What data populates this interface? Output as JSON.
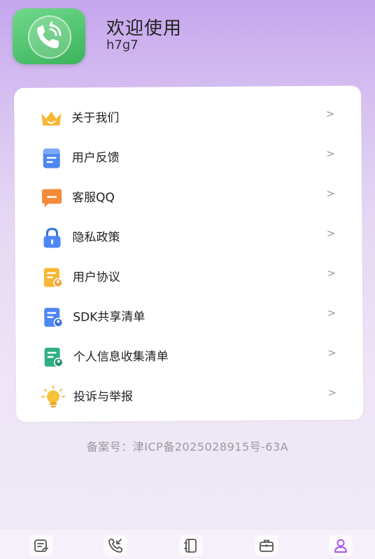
{
  "header": {
    "welcome": "欢迎使用",
    "username": "h7g7",
    "app_icon": "phone-callback-icon"
  },
  "menu": {
    "chevron": ">",
    "items": [
      {
        "label": "关于我们",
        "icon": "crown-icon"
      },
      {
        "label": "用户反馈",
        "icon": "document-icon"
      },
      {
        "label": "客服QQ",
        "icon": "chat-bubble-icon"
      },
      {
        "label": "隐私政策",
        "icon": "lock-icon"
      },
      {
        "label": "用户协议",
        "icon": "user-agreement-icon"
      },
      {
        "label": "SDK共享清单",
        "icon": "sdk-list-icon"
      },
      {
        "label": "个人信息收集清单",
        "icon": "personal-info-list-icon"
      },
      {
        "label": "投诉与举报",
        "icon": "lightbulb-icon"
      }
    ]
  },
  "footer": {
    "record": "备案号：津ICP备2025028915号-63A"
  },
  "tabbar": {
    "tabs": [
      {
        "icon": "record-icon",
        "active": false
      },
      {
        "icon": "incoming-call-icon",
        "active": false
      },
      {
        "icon": "contacts-book-icon",
        "active": false
      },
      {
        "icon": "briefcase-icon",
        "active": false
      },
      {
        "icon": "user-icon",
        "active": true
      }
    ]
  },
  "colors": {
    "accent": "#a64ff0",
    "icon_green": "#3cb35c",
    "icon_orange": "#f5a33a",
    "icon_blue": "#4d86f5",
    "icon_teal": "#2fae84"
  }
}
